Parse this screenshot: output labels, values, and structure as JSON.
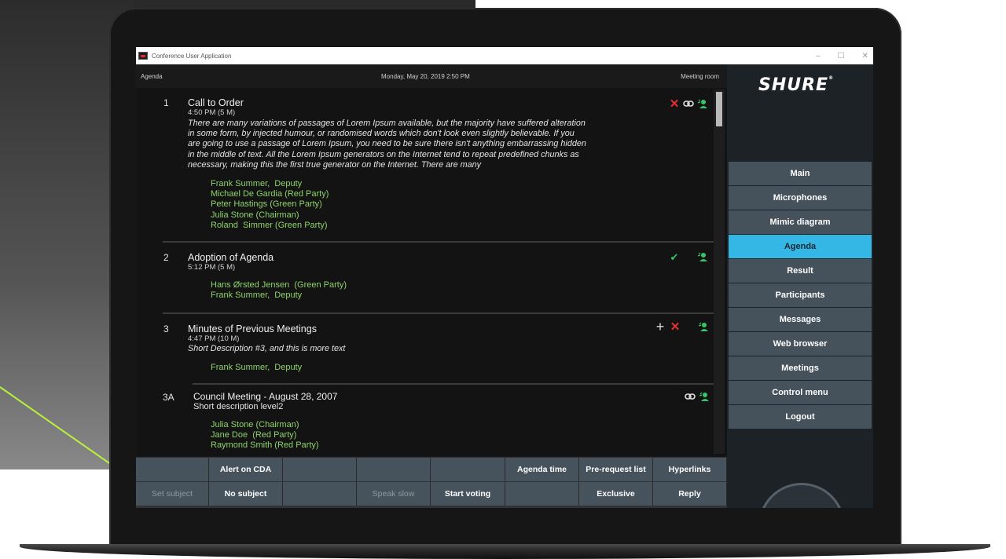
{
  "window": {
    "title": "Conference User Application",
    "controls": {
      "minimize": "–",
      "maximize": "☐",
      "close": "✕"
    }
  },
  "topbar": {
    "section": "Agenda",
    "datetime": "Monday, May 20, 2019 2:50 PM",
    "room": "Meeting room"
  },
  "agenda": [
    {
      "num": "1",
      "title": "Call to Order",
      "time": "4:50 PM (5 M)",
      "desc": [
        "There are many variations of passages of Lorem Ipsum available, but the majority have suffered alteration",
        "in some form, by injected humour, or randomised words which don't look even slightly believable. If you",
        "are going to use a passage of Lorem Ipsum, you need to be sure there isn't anything embarrassing hidden",
        "in the middle of text. All the Lorem Ipsum generators on the Internet tend to repeat predefined chunks as",
        "necessary, making this the first true generator on the Internet. There are many"
      ],
      "participants": [
        "Frank Summer,  Deputy",
        "Michael De Gardia (Red Party)",
        "Peter Hastings (Green Party)",
        "Julia Stone (Chairman)",
        "Roland  Simmer (Green Party)"
      ],
      "icons": [
        "close-icon",
        "link-icon",
        "speaker-icon"
      ]
    },
    {
      "num": "2",
      "title": "Adoption of Agenda",
      "time": "5:12 PM (5 M)",
      "participants": [
        "Hans Ørsted Jensen  (Green Party)",
        "Frank Summer,  Deputy"
      ],
      "icons": [
        "check-icon",
        "speaker-icon"
      ]
    },
    {
      "num": "3",
      "title": "Minutes of Previous Meetings",
      "time": "4:47 PM (10 M)",
      "desc_line": "Short Description #3, and this is more text",
      "participants": [
        "Frank Summer,  Deputy"
      ],
      "icons": [
        "plus-icon",
        "close-icon",
        "speaker-icon"
      ]
    },
    {
      "num": "3A",
      "title": "Council Meeting - August 28, 2007",
      "desc_line": "Short description level2",
      "participants": [
        "Julia Stone (Chairman)",
        "Jane Doe  (Red Party)",
        "Raymond Smith (Red Party)"
      ],
      "icons": [
        "link-icon",
        "speaker-icon"
      ]
    }
  ],
  "bottom_bar": {
    "row1": [
      "",
      "Alert on CDA",
      "",
      "",
      "",
      "Agenda time",
      "Pre-request list",
      "Hyperlinks"
    ],
    "row2": [
      "Set subject",
      "No subject",
      "",
      "Speak slow",
      "Start voting",
      "",
      "Exclusive",
      "Reply"
    ]
  },
  "sidebar": {
    "logo": "SHURE",
    "logo_mark": "®",
    "menu": [
      "Main",
      "Microphones",
      "Mimic diagram",
      "Agenda",
      "Result",
      "Participants",
      "Messages",
      "Web browser",
      "Meetings",
      "Control menu",
      "Logout"
    ],
    "active": "Agenda"
  },
  "colors": {
    "accent": "#35b7e5",
    "participant_green": "#8ed36a",
    "remove_red": "#e23232",
    "approved_green": "#35c56a",
    "button": "#47535c"
  }
}
